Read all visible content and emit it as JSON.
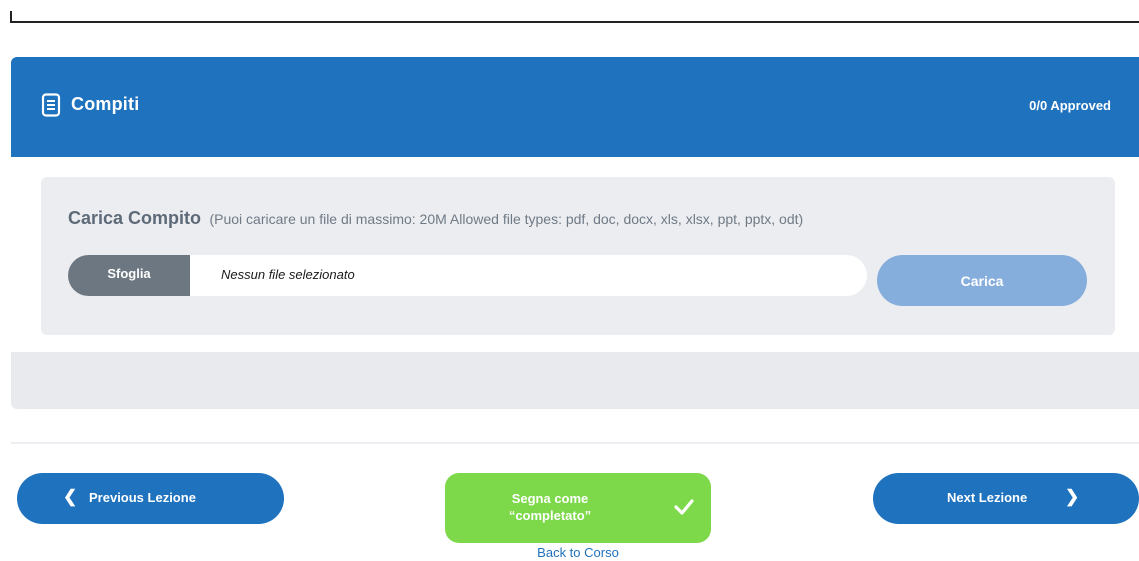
{
  "header": {
    "icon": "document-icon",
    "title": "Compiti",
    "status": "0/0 Approved"
  },
  "upload": {
    "title": "Carica Compito",
    "note": "(Puoi caricare un file di massimo: 20M Allowed file types: pdf, doc, docx, xls, xlsx, ppt, pptx, odt)",
    "browse_label": "Sfoglia",
    "file_name": "Nessun file selezionato",
    "submit_label": "Carica"
  },
  "navigation": {
    "prev_label": "Previous Lezione",
    "prev_icon": "chevron-left-icon",
    "next_label": "Next Lezione",
    "next_icon": "chevron-right-icon",
    "complete_line1": "Segna come",
    "complete_line2": "“completato”",
    "complete_icon": "checkmark-icon",
    "back_label": "Back to Corso"
  },
  "colors": {
    "primary": "#1e72be",
    "success": "#7dd84a",
    "upload_disabled": "#86aedc",
    "browse": "#6c7782"
  }
}
